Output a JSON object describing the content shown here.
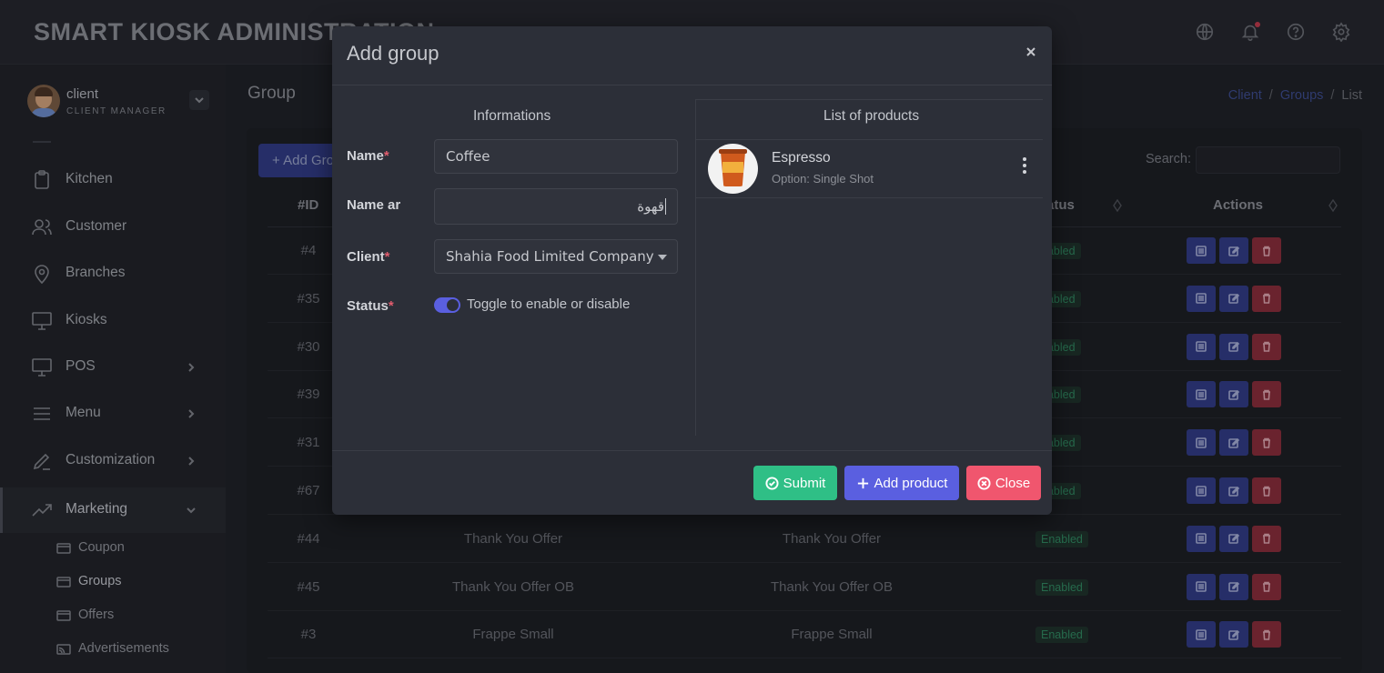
{
  "app": {
    "title": "SMART KIOSK ADMINISTRATION"
  },
  "user": {
    "name": "client",
    "role": "CLIENT MANAGER"
  },
  "sidebar": {
    "items": [
      {
        "label": "Kitchen",
        "icon": "clipboard-icon"
      },
      {
        "label": "Customer",
        "icon": "users-icon"
      },
      {
        "label": "Branches",
        "icon": "map-pin-icon"
      },
      {
        "label": "Kiosks",
        "icon": "monitor-icon"
      },
      {
        "label": "POS",
        "icon": "monitor-icon"
      },
      {
        "label": "Menu",
        "icon": "menu-icon"
      },
      {
        "label": "Customization",
        "icon": "pen-icon"
      },
      {
        "label": "Marketing",
        "icon": "trending-up-icon"
      }
    ],
    "sub_items": [
      {
        "label": "Coupon"
      },
      {
        "label": "Groups"
      },
      {
        "label": "Offers"
      },
      {
        "label": "Advertisements"
      }
    ]
  },
  "page": {
    "title": "Group",
    "breadcrumb": [
      "Client",
      "Groups",
      "List"
    ],
    "breadcrumb_sep": "/",
    "add_button": "Add Gro",
    "search_label": "Search:"
  },
  "table": {
    "headers": {
      "id": "#ID",
      "status": "atus",
      "actions": "Actions"
    },
    "rows": [
      {
        "id": "#4",
        "name": "",
        "name_ar": "",
        "status": "nabled"
      },
      {
        "id": "#35",
        "name": "",
        "name_ar": "",
        "status": "nabled"
      },
      {
        "id": "#30",
        "name": "",
        "name_ar": "",
        "status": "nabled"
      },
      {
        "id": "#39",
        "name": "",
        "name_ar": "",
        "status": "nabled"
      },
      {
        "id": "#31",
        "name": "",
        "name_ar": "",
        "status": "nabled"
      },
      {
        "id": "#67",
        "name": "",
        "name_ar": "",
        "status": "nabled"
      },
      {
        "id": "#44",
        "name": "Thank You Offer",
        "name_ar": "Thank You Offer",
        "status": "Enabled"
      },
      {
        "id": "#45",
        "name": "Thank You Offer OB",
        "name_ar": "Thank You Offer OB",
        "status": "Enabled"
      },
      {
        "id": "#3",
        "name": "Frappe Small",
        "name_ar": "Frappe Small",
        "status": "Enabled"
      }
    ]
  },
  "modal": {
    "title": "Add group",
    "info_header": "Informations",
    "products_header": "List of products",
    "fields": {
      "name_label": "Name",
      "name_value": "Coffee",
      "name_ar_label": "Name ar",
      "name_ar_value": "قهوة",
      "client_label": "Client",
      "client_value": "Shahia Food Limited Company",
      "status_label": "Status",
      "status_toggle_label": "Toggle to enable or disable",
      "required_mark": "*"
    },
    "products": [
      {
        "name": "Espresso",
        "option": "Option: Single Shot"
      }
    ],
    "buttons": {
      "submit": "Submit",
      "add_product": "Add product",
      "close": "Close"
    }
  },
  "colors": {
    "primary": "#5a5fe0",
    "success": "#2fbf86",
    "danger": "#f0566e",
    "modal_bg": "#2c2f38"
  }
}
